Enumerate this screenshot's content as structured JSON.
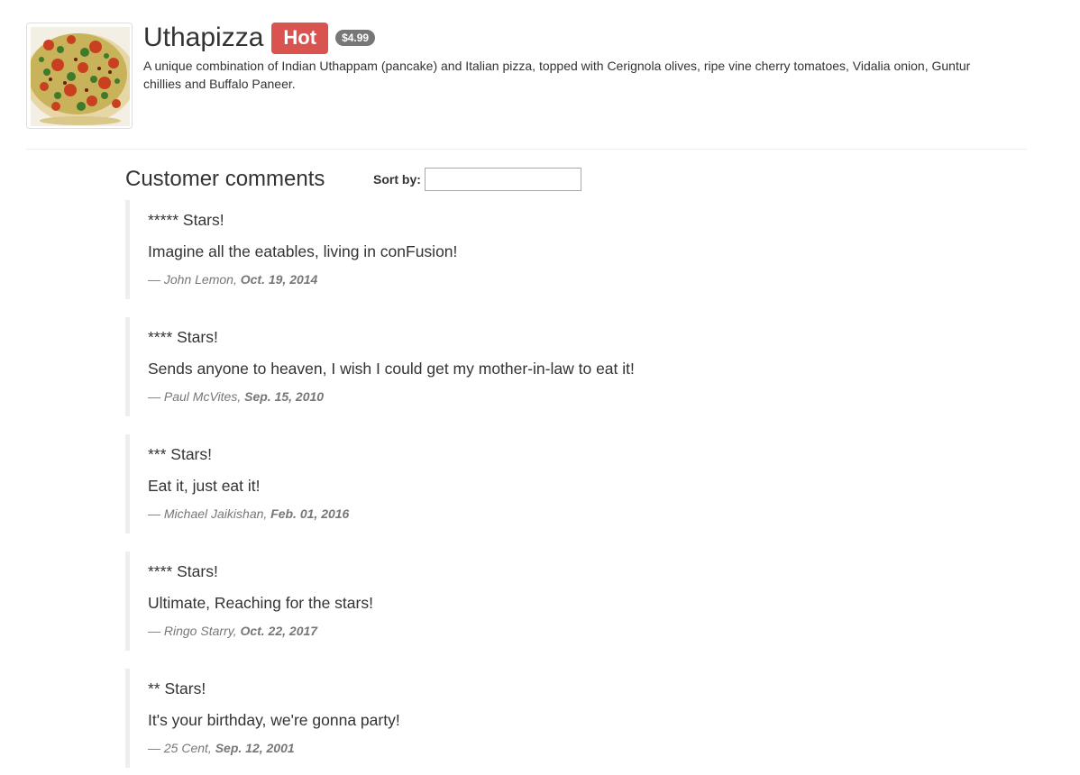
{
  "dish": {
    "image_alt": "Uthapizza",
    "name": "Uthapizza",
    "label": "Hot",
    "price": "$4.99",
    "description": "A unique combination of Indian Uthappam (pancake) and Italian pizza, topped with Cerignola olives, ripe vine cherry tomatoes, Vidalia onion, Guntur chillies and Buffalo Paneer.",
    "colors": {
      "label": "#d9534f",
      "badge": "#777777"
    }
  },
  "comments_section": {
    "title": "Customer comments",
    "sort_label": "Sort by:",
    "sort_value": "",
    "items": [
      {
        "stars": "***** Stars!",
        "comment": "Imagine all the eatables, living in conFusion!",
        "author": "— John Lemon,",
        "date": "Oct. 19, 2014"
      },
      {
        "stars": "**** Stars!",
        "comment": "Sends anyone to heaven, I wish I could get my mother-in-law to eat it!",
        "author": "— Paul McVites,",
        "date": "Sep. 15, 2010"
      },
      {
        "stars": "*** Stars!",
        "comment": "Eat it, just eat it!",
        "author": "— Michael Jaikishan,",
        "date": "Feb. 01, 2016"
      },
      {
        "stars": "**** Stars!",
        "comment": "Ultimate, Reaching for the stars!",
        "author": "— Ringo Starry,",
        "date": "Oct. 22, 2017"
      },
      {
        "stars": "** Stars!",
        "comment": "It's your birthday, we're gonna party!",
        "author": "— 25 Cent,",
        "date": "Sep. 12, 2001"
      }
    ]
  }
}
